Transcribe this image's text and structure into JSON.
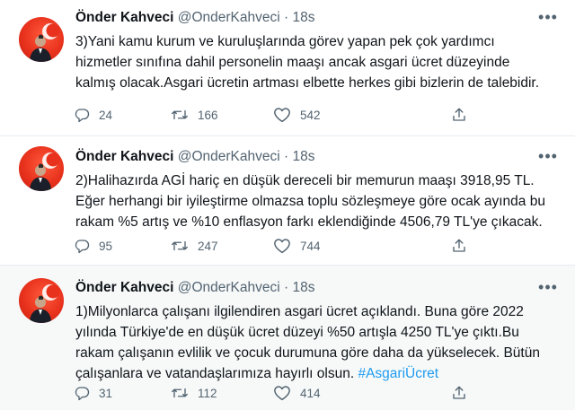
{
  "tweets": [
    {
      "author_name": "Önder Kahveci",
      "handle": "@OnderKahveci",
      "separator": "·",
      "time": "18s",
      "more_icon": "more-horizontal-icon",
      "lines": [
        "3)Yani kamu kurum ve kuruluşlarında görev yapan pek çok yardımcı",
        "hizmetler sınıfına dahil personelin maaşı ancak asgari ücret düzeyinde",
        "kalmış olacak.Asgari ücretin artması elbette herkes gibi bizlerin de talebidir."
      ],
      "replies": "24",
      "retweets": "166",
      "likes": "542"
    },
    {
      "author_name": "Önder Kahveci",
      "handle": "@OnderKahveci",
      "separator": "·",
      "time": "18s",
      "more_icon": "more-horizontal-icon",
      "lines": [
        "2)Halihazırda AGİ hariç en düşük dereceli bir memurun maaşı 3918,95 TL.",
        "Eğer herhangi bir iyileştirme olmazsa toplu sözleşmeye göre ocak ayında bu",
        "rakam %5 artış ve %10 enflasyon farkı eklendiğinde 4506,79 TL'ye çıkacak."
      ],
      "replies": "95",
      "retweets": "247",
      "likes": "744"
    },
    {
      "author_name": "Önder Kahveci",
      "handle": "@OnderKahveci",
      "separator": "·",
      "time": "18s",
      "more_icon": "more-horizontal-icon",
      "lines": [
        "1)Milyonlarca çalışanı ilgilendiren asgari ücret açıklandı. Buna göre 2022",
        "yılında Türkiye'de en düşük ücret düzeyi %50 artışla 4250 TL'ye çıktı.Bu",
        "rakam çalışanın evlilik ve çocuk durumuna göre daha da yükselecek. Bütün"
      ],
      "last_line_text": "çalışanlara ve vatandaşlarımıza hayırlı olsun.",
      "hashtag": "#AsgariÜcret",
      "replies": "31",
      "retweets": "112",
      "likes": "414"
    }
  ],
  "colors": {
    "text": "#0f1419",
    "muted": "#536471",
    "link": "#1d9bf0",
    "avatar_red": "#e8321d",
    "highlight_bg": "#f7f9f9"
  },
  "icons": [
    "reply-icon",
    "retweet-icon",
    "like-icon",
    "share-icon",
    "more-horizontal-icon",
    "avatar"
  ]
}
